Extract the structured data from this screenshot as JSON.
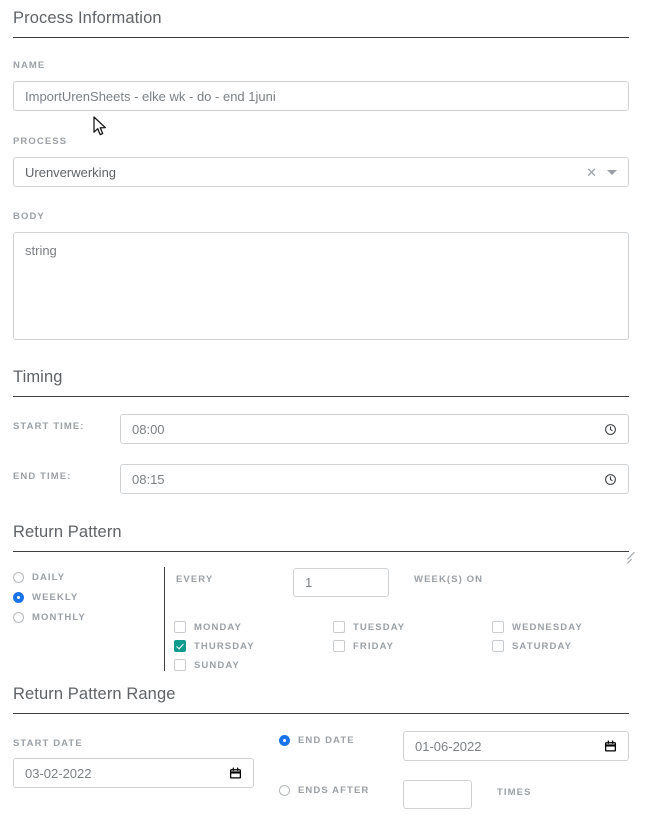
{
  "sections": {
    "process_information": {
      "title": "Process Information"
    },
    "timing": {
      "title": "Timing"
    },
    "return_pattern": {
      "title": "Return Pattern"
    },
    "return_pattern_range": {
      "title": "Return Pattern Range"
    }
  },
  "process_information": {
    "name": {
      "label": "NAME",
      "value": "ImportUrenSheets - elke wk - do - end 1juni"
    },
    "process": {
      "label": "PROCESS",
      "value": "Urenverwerking",
      "clear_icon": "close-icon",
      "dropdown_icon": "chevron-down-icon"
    },
    "body": {
      "label": "BODY",
      "value": "string"
    }
  },
  "timing": {
    "start_time": {
      "label": "START TIME:",
      "value": "08:00",
      "icon": "clock-icon"
    },
    "end_time": {
      "label": "END TIME:",
      "value": "08:15",
      "icon": "clock-icon"
    }
  },
  "return_pattern": {
    "frequency_options": [
      {
        "label": "DAILY",
        "selected": false
      },
      {
        "label": "WEEKLY",
        "selected": true
      },
      {
        "label": "MONTHLY",
        "selected": false
      }
    ],
    "every_label": "EVERY",
    "interval_value": "1",
    "unit_label": "WEEK(S) ON",
    "days": [
      {
        "label": "MONDAY",
        "checked": false
      },
      {
        "label": "TUESDAY",
        "checked": false
      },
      {
        "label": "WEDNESDAY",
        "checked": false
      },
      {
        "label": "THURSDAY",
        "checked": true
      },
      {
        "label": "FRIDAY",
        "checked": false
      },
      {
        "label": "SATURDAY",
        "checked": false
      },
      {
        "label": "SUNDAY",
        "checked": false
      }
    ]
  },
  "return_pattern_range": {
    "start_date": {
      "label": "START DATE",
      "value": "03-02-2022",
      "icon": "calendar-icon"
    },
    "end_date": {
      "label": "END DATE",
      "value": "01-06-2022",
      "selected": true,
      "icon": "calendar-icon"
    },
    "ends_after": {
      "label": "ENDS AFTER",
      "value": "",
      "selected": false,
      "suffix_label": "TIMES"
    }
  },
  "colors": {
    "radio_selected": "#1a73e8",
    "checkbox_checked": "#0f9b8e",
    "label_text": "#9aa0a6",
    "heading_text": "#5f6368",
    "rule": "#3c4043",
    "input_border": "#d0d3d6"
  },
  "cursor": {
    "icon": "mouse-pointer-icon"
  }
}
